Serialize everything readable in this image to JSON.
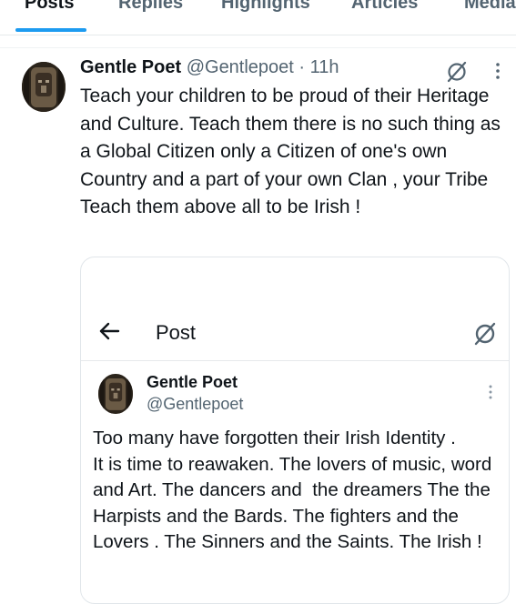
{
  "tabs": [
    "Posts",
    "Replies",
    "Highlights",
    "Articles",
    "Media"
  ],
  "active_tab": "Posts",
  "tweet": {
    "name": "Gentle Poet",
    "handle": "@Gentlepoet",
    "dot": "·",
    "time": "11h",
    "text": "Teach your children to be proud of their Heritage and Culture. Teach them there is no such thing as a Global Citizen only a Citizen of one's own Country and a part of your own Clan , your Tribe Teach them above all to be Irish !"
  },
  "card": {
    "title": "Post",
    "inner_name": "Gentle Poet",
    "inner_handle": "@Gentlepoet",
    "inner_text": "Too many have forgotten their Irish Identity .\nIt is time to reawaken. The lovers of music, word and Art. The dancers and  the dreamers The the Harpists and the Bards. The fighters and the Lovers . The Sinners and the Saints. The Irish !"
  },
  "icons": {
    "grok": "grok-icon",
    "more": "more-vertical-icon",
    "back": "arrow-left-icon"
  },
  "colors": {
    "accent": "#1d9bf0",
    "text": "#0f1419",
    "muted": "#536471",
    "border": "#e1e6ea"
  }
}
